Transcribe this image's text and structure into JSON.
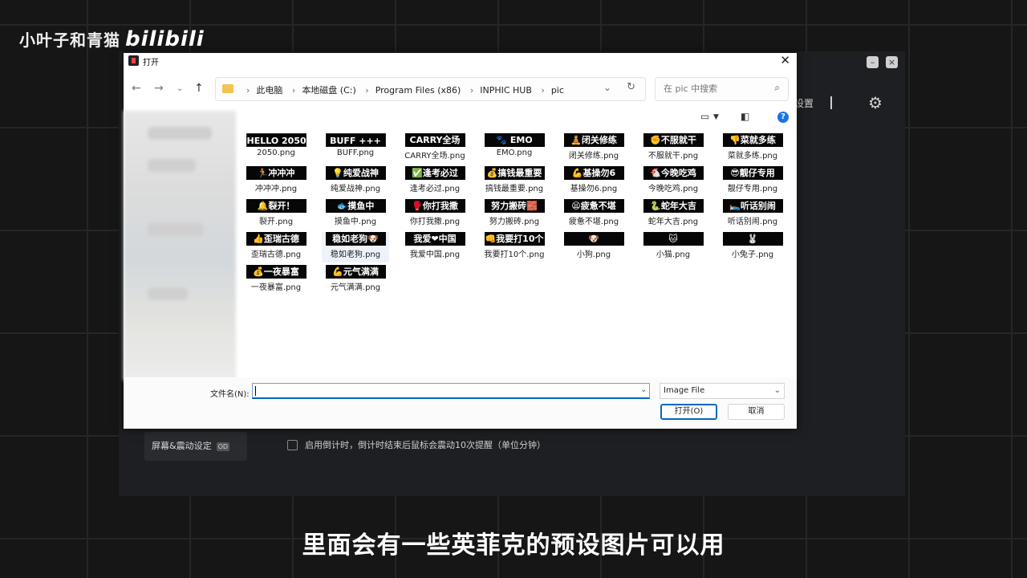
{
  "watermark": {
    "channel": "小叶子和青猫",
    "logo": "bilibili"
  },
  "app": {
    "settings_label": "设置",
    "sidebar_item": "屏幕&震动设定",
    "sidebar_tag": "OD",
    "countdown_option": "启用倒计时，倒计时结束后鼠标会震动10次提醒（单位分钟）"
  },
  "dialog": {
    "title": "打开",
    "breadcrumbs": [
      "此电脑",
      "本地磁盘 (C:)",
      "Program Files (x86)",
      "INPHIC HUB",
      "pic"
    ],
    "search_placeholder": "在 pic 中搜索",
    "filename_label": "文件名(N):",
    "filename_value": "",
    "filetype": "Image File",
    "open_button": "打开(O)",
    "cancel_button": "取消",
    "files": [
      {
        "thumb": "HELLO 2050",
        "name": "2050.png"
      },
      {
        "thumb": "BUFF +++",
        "name": "BUFF.png"
      },
      {
        "thumb": "CARRY全场",
        "name": "CARRY全场.png"
      },
      {
        "thumb": "🐾 EMO",
        "name": "EMO.png"
      },
      {
        "thumb": "🧘闭关修练",
        "name": "闭关修练.png"
      },
      {
        "thumb": "✊不服就干",
        "name": "不服就干.png"
      },
      {
        "thumb": "👎菜就多练",
        "name": "菜就多练.png"
      },
      {
        "thumb": "🏃冲冲冲",
        "name": "冲冲冲.png"
      },
      {
        "thumb": "💡纯爱战神",
        "name": "纯爱战神.png"
      },
      {
        "thumb": "✅逢考必过",
        "name": "逢考必过.png"
      },
      {
        "thumb": "💰搞钱最重要",
        "name": "搞钱最重要.png"
      },
      {
        "thumb": "💪基操勿6",
        "name": "基操勿6.png"
      },
      {
        "thumb": "🐔今晚吃鸡",
        "name": "今晚吃鸡.png"
      },
      {
        "thumb": "😎靓仔专用",
        "name": "靓仔专用.png"
      },
      {
        "thumb": "🔔裂开！",
        "name": "裂开.png"
      },
      {
        "thumb": "🐟摸鱼中",
        "name": "摸鱼中.png"
      },
      {
        "thumb": "🥊你打我撒",
        "name": "你打我撒.png"
      },
      {
        "thumb": "努力搬砖🧱",
        "name": "努力搬砖.png"
      },
      {
        "thumb": "😫疲惫不堪",
        "name": "疲惫不堪.png"
      },
      {
        "thumb": "🐍蛇年大吉",
        "name": "蛇年大吉.png"
      },
      {
        "thumb": "🛌听话别闹",
        "name": "听话别闹.png"
      },
      {
        "thumb": "👍歪瑞古德",
        "name": "歪瑞古德.png"
      },
      {
        "thumb": "稳如老狗🐶",
        "name": "稳如老狗.png"
      },
      {
        "thumb": "我爱❤中国",
        "name": "我爱中国.png"
      },
      {
        "thumb": "👊我要打10个",
        "name": "我要打10个.png"
      },
      {
        "thumb": "🐶",
        "name": "小狗.png"
      },
      {
        "thumb": "🐱",
        "name": "小猫.png"
      },
      {
        "thumb": "🐰",
        "name": "小兔子.png"
      },
      {
        "thumb": "💰一夜暴富",
        "name": "一夜暴富.png"
      },
      {
        "thumb": "💪元气满满",
        "name": "元气满满.png"
      }
    ]
  },
  "subtitle": "里面会有一些英菲克的预设图片可以用"
}
